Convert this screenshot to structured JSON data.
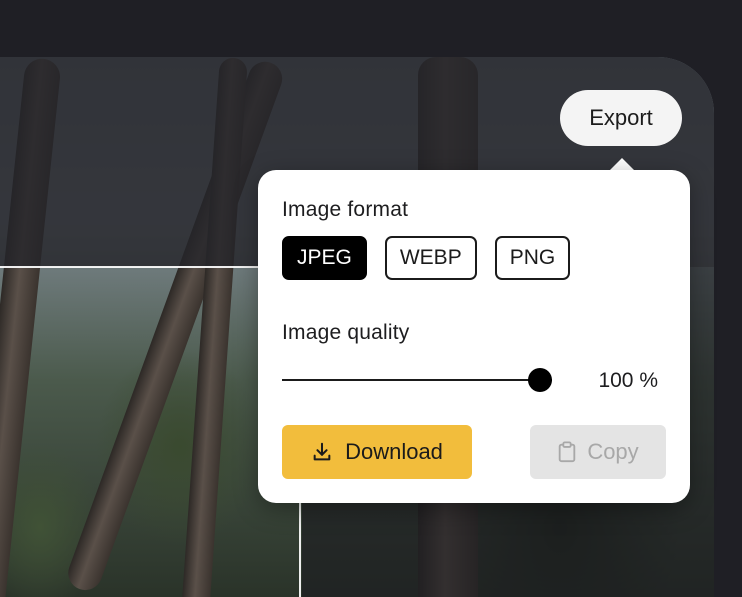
{
  "toolbar": {
    "export_label": "Export"
  },
  "export_popover": {
    "format_label": "Image format",
    "formats": [
      "JPEG",
      "WEBP",
      "PNG"
    ],
    "selected_format": "JPEG",
    "quality_label": "Image quality",
    "quality_value": 1.0,
    "quality_text": "100 %",
    "download_label": "Download",
    "download_icon": "download-icon",
    "copy_label": "Copy",
    "copy_icon": "clipboard-icon",
    "copy_disabled": true
  },
  "colors": {
    "app_background": "#1f1f25",
    "download_accent": "#f2bd3c",
    "selected_chip": "#000000",
    "disabled_button": "#e4e4e4"
  }
}
